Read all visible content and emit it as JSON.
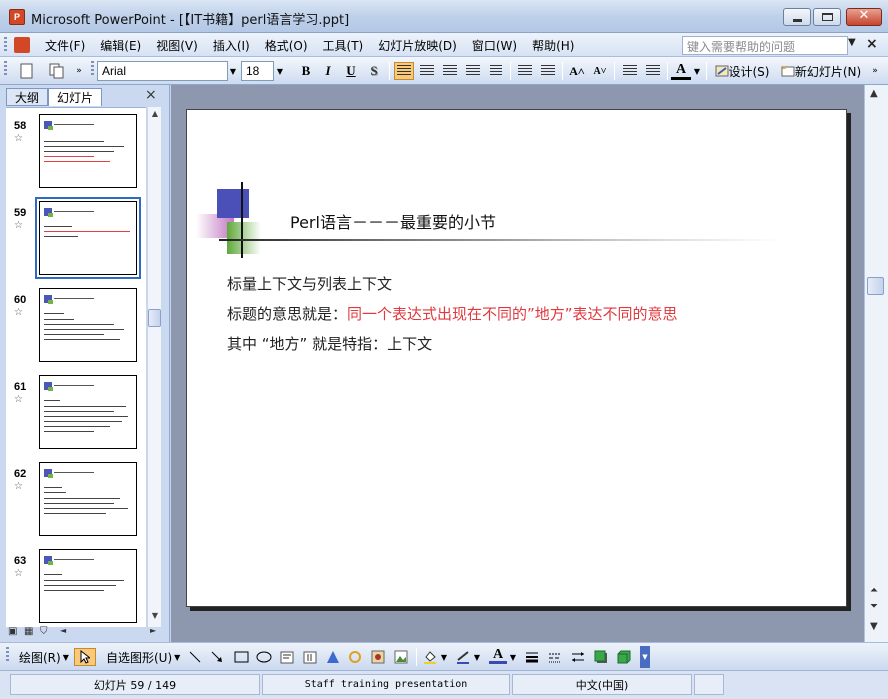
{
  "window": {
    "app_icon_text": "P",
    "title": "Microsoft PowerPoint - [【IT书籍】perl语言学习.ppt]",
    "close_glyph": "✕"
  },
  "menubar": {
    "items": [
      "文件(F)",
      "编辑(E)",
      "视图(V)",
      "插入(I)",
      "格式(O)",
      "工具(T)",
      "幻灯片放映(D)",
      "窗口(W)",
      "帮助(H)"
    ],
    "help_placeholder": "键入需要帮助的问题",
    "close_glyph": "×"
  },
  "toolbar": {
    "font_name": "Arial",
    "font_size": "18",
    "bold": "B",
    "italic": "I",
    "underline": "U",
    "shadow": "S",
    "grow_font": "A˄",
    "shrink_font": "A˅",
    "font_color": "A",
    "design_label": "设计(S)",
    "new_slide_label": "新幻灯片(N)"
  },
  "left_panel": {
    "tabs": [
      "大纲",
      "幻灯片"
    ],
    "close_glyph": "×",
    "star_glyph": "☆",
    "thumbnails": [
      {
        "number": "58",
        "selected": false
      },
      {
        "number": "59",
        "selected": true
      },
      {
        "number": "60",
        "selected": false
      },
      {
        "number": "61",
        "selected": false
      },
      {
        "number": "62",
        "selected": false
      },
      {
        "number": "63",
        "selected": false
      }
    ]
  },
  "slide": {
    "title": "Perl语言－－－最重要的小节",
    "line1": "标量上下文与列表上下文",
    "line2_prefix": "标题的意思就是：",
    "line2_red": "同一个表达式出现在不同的”地方”表达不同的意思",
    "line3": "其中 “地方” 就是特指：上下文"
  },
  "drawing_toolbar": {
    "draw_label": "绘图(R)",
    "autoshapes_label": "自选图形(U)"
  },
  "statusbar": {
    "slide_position": "幻灯片 59 / 149",
    "design_name": "Staff training presentation",
    "language": "中文(中国)"
  },
  "colors": {
    "accent_red": "#e0393e",
    "logo_blue": "#4b4fb8",
    "logo_green": "#5fa83a",
    "logo_purple": "#b75fb7",
    "selection_blue": "#316ac5"
  }
}
